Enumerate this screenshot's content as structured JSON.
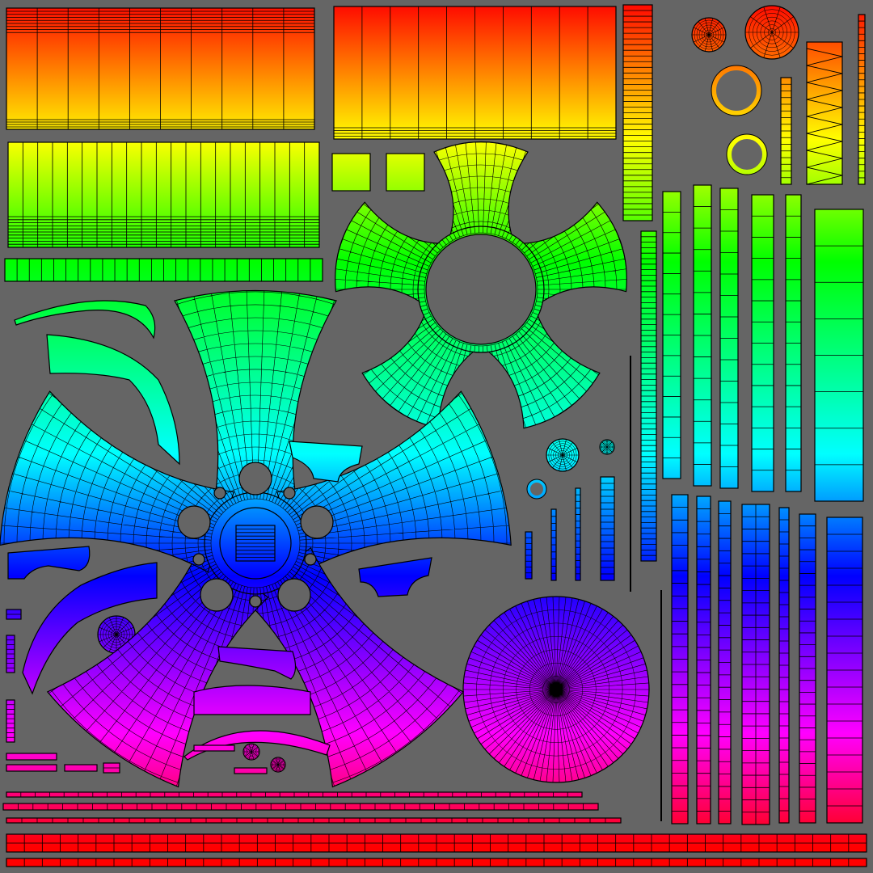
{
  "image": {
    "subject": "uv-layout",
    "background_color": "#656565",
    "gradient_stops": [
      "#ff0000",
      "#ffff00",
      "#00ff00",
      "#00ffff",
      "#0000ff",
      "#ff00ff",
      "#ff0000"
    ],
    "wire_color": "#000000"
  }
}
